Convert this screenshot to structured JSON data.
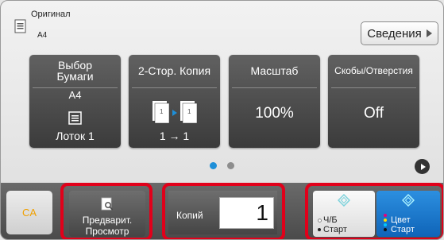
{
  "header": {
    "original_label": "Оригинал",
    "original_size": "A4",
    "details_label": "Сведения"
  },
  "tiles": {
    "paper": {
      "title": "Выбор\nБумаги",
      "size": "A4",
      "tray": "Лоток 1"
    },
    "duplex": {
      "title": "2-Стор. Копия",
      "mode": "1 → 1"
    },
    "zoom": {
      "title": "Масштаб",
      "value": "100%"
    },
    "staple": {
      "title": "Скобы/Отверстия",
      "value": "Off"
    }
  },
  "pager": {
    "current": 1,
    "total": 2
  },
  "bottom": {
    "ca_label": "CA",
    "preview_line1": "Предварит.",
    "preview_line2": "Просмотр",
    "copies_label": "Копий",
    "copies_value": "1",
    "bw_line1": "Ч/Б",
    "bw_line2": "Старт",
    "color_line1": "Цвет",
    "color_line2": "Старт"
  },
  "colors": {
    "accent_blue": "#1e8fd8",
    "highlight_red": "#e1001a",
    "ca_orange": "#f0a000"
  }
}
